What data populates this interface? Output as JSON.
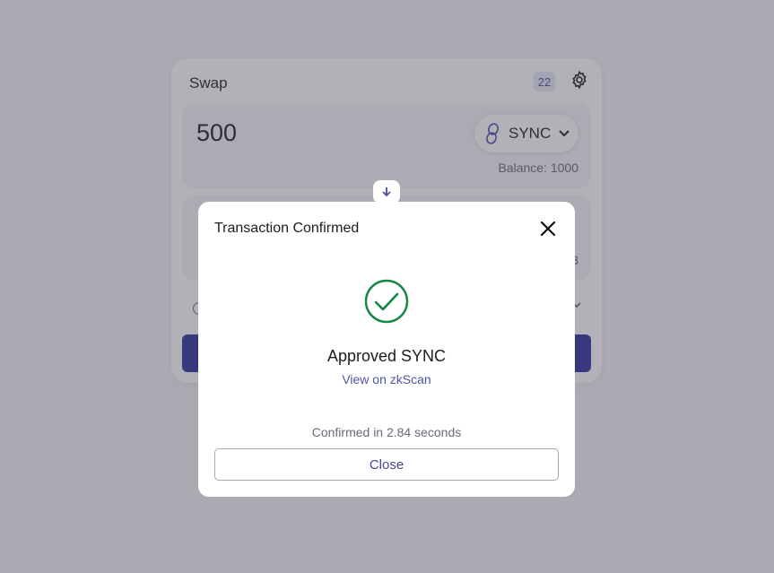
{
  "swap": {
    "title": "Swap",
    "slippage_badge": "22",
    "from": {
      "amount": "500",
      "token": "SYNC",
      "balance": "Balance: 1000"
    },
    "to": {
      "balance_fragment": "3"
    },
    "colors": {
      "accent": "#2f2f9e",
      "panel": "#f4f4f8"
    }
  },
  "modal": {
    "title": "Transaction Confirmed",
    "status": "Approved SYNC",
    "link": "View on zkScan",
    "confirmation": "Confirmed in 2.84 seconds",
    "close_label": "Close",
    "colors": {
      "success": "#12873f",
      "link": "#50549e"
    }
  }
}
